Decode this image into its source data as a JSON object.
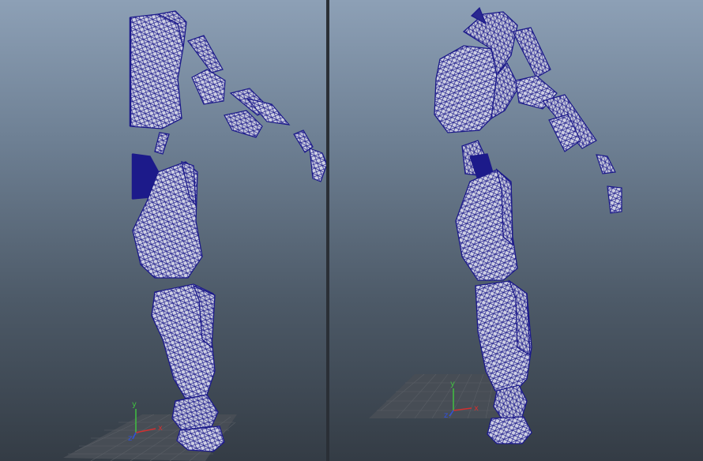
{
  "viewports": {
    "left": {
      "name": "",
      "axis": {
        "x": "x",
        "y": "y",
        "z": "z"
      }
    },
    "right": {
      "name": "",
      "axis": {
        "x": "x",
        "y": "y",
        "z": "z"
      }
    }
  },
  "colors": {
    "wireframe": "#1c1a8a",
    "mesh_fill": "#c9cbe0",
    "axis_x": "#d03030",
    "axis_y": "#40c040",
    "axis_z": "#3050e0",
    "grid": "#5a5f66"
  }
}
